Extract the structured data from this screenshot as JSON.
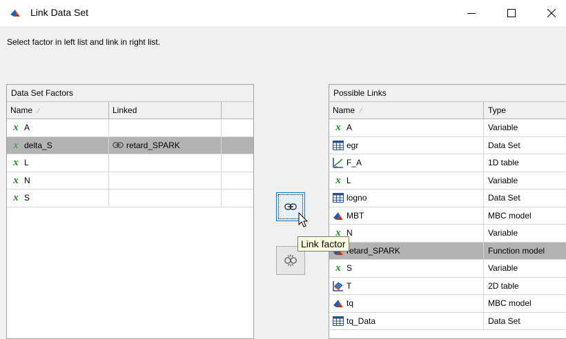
{
  "window": {
    "title": "Link Data Set",
    "minimize_icon": "minimize-icon",
    "maximize_icon": "maximize-icon",
    "close_icon": "close-icon"
  },
  "instruction": "Select factor in left list and link in right list.",
  "left_panel": {
    "title": "Data Set Factors",
    "columns": {
      "name": "Name",
      "linked": "Linked"
    },
    "sort_indicator": "⁄",
    "rows": [
      {
        "name": "A",
        "linked": "",
        "icon": "variable-icon",
        "selected": false
      },
      {
        "name": "delta_S",
        "linked": "retard_SPARK",
        "icon": "variable-icon",
        "linked_icon": "link-icon",
        "selected": true
      },
      {
        "name": "L",
        "linked": "",
        "icon": "variable-icon",
        "selected": false
      },
      {
        "name": "N",
        "linked": "",
        "icon": "variable-icon",
        "selected": false
      },
      {
        "name": "S",
        "linked": "",
        "icon": "variable-icon",
        "selected": false
      }
    ]
  },
  "right_panel": {
    "title": "Possible Links",
    "columns": {
      "name": "Name",
      "type": "Type"
    },
    "sort_indicator": "⁄",
    "rows": [
      {
        "name": "A",
        "type": "Variable",
        "icon": "variable-icon",
        "selected": false
      },
      {
        "name": "egr",
        "type": "Data Set",
        "icon": "table-icon",
        "selected": false
      },
      {
        "name": "F_A",
        "type": "1D table",
        "icon": "1d-table-icon",
        "selected": false
      },
      {
        "name": "L",
        "type": "Variable",
        "icon": "variable-icon",
        "selected": false
      },
      {
        "name": "logno",
        "type": "Data Set",
        "icon": "table-icon",
        "selected": false
      },
      {
        "name": "MBT",
        "type": "MBC model",
        "icon": "model-icon",
        "selected": false
      },
      {
        "name": "N",
        "type": "Variable",
        "icon": "variable-icon",
        "selected": false
      },
      {
        "name": "retard_SPARK",
        "type": "Function model",
        "icon": "model-icon",
        "selected": true
      },
      {
        "name": "S",
        "type": "Variable",
        "icon": "variable-icon",
        "selected": false
      },
      {
        "name": "T",
        "type": "2D table",
        "icon": "2d-table-icon",
        "selected": false
      },
      {
        "name": "tq",
        "type": "MBC model",
        "icon": "model-icon",
        "selected": false
      },
      {
        "name": "tq_Data",
        "type": "Data Set",
        "icon": "table-icon",
        "selected": false
      }
    ]
  },
  "buttons": {
    "link": {
      "icon": "link-icon"
    },
    "unlink": {
      "icon": "unlink-icon"
    }
  },
  "tooltip": "Link factor",
  "colors": {
    "selected_row": "#b3b3b3",
    "variable_x": "#1a8a1a",
    "tooltip_bg": "#ffffe1",
    "focus_border": "#0078d7"
  }
}
